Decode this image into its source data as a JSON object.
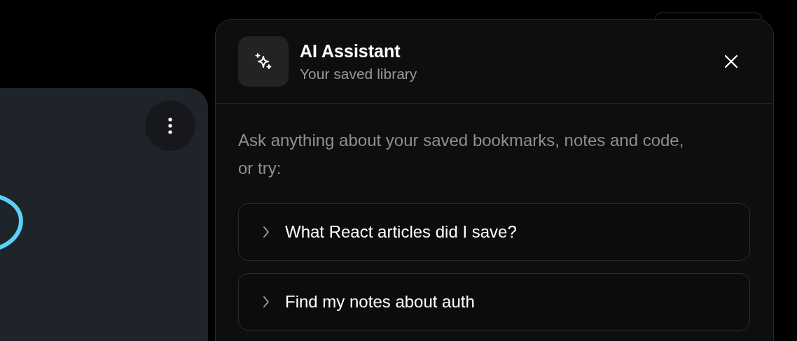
{
  "assistant": {
    "title": "AI Assistant",
    "subtitle": "Your saved library",
    "intro": "Ask anything about your saved bookmarks, notes and code, or try:",
    "suggestions": [
      {
        "label": "What React articles did I save?"
      },
      {
        "label": "Find my notes about auth"
      }
    ]
  }
}
